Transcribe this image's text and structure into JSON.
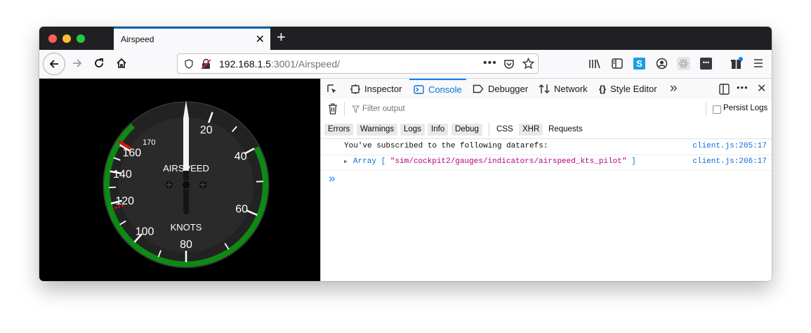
{
  "browser": {
    "tab_title": "Airspeed",
    "url_host": "192.168.1.5",
    "url_rest": ":3001/Airspeed/"
  },
  "gauge": {
    "label_top": "AIRSPEED",
    "label_bottom": "KNOTS",
    "scale_labels": [
      "20",
      "40",
      "60",
      "80",
      "100",
      "120",
      "140",
      "160",
      "170"
    ],
    "needle_value": 0,
    "colors": {
      "green_arc": "#0e8a14",
      "red_line": "#e01010",
      "dial": "#222222"
    }
  },
  "devtools": {
    "tabs": [
      "Inspector",
      "Console",
      "Debugger",
      "Network",
      "Style Editor"
    ],
    "active_tab": "Console",
    "filter_placeholder": "Filter output",
    "persist_logs": "Persist Logs",
    "categories": [
      "Errors",
      "Warnings",
      "Logs",
      "Info",
      "Debug"
    ],
    "categories2": [
      "CSS",
      "XHR",
      "Requests"
    ],
    "messages": [
      {
        "text": "You've subscribed to the following datarefs:",
        "source": "client.js:205:17"
      },
      {
        "prefix": "Array [ ",
        "value": "\"sim/cockpit2/gauges/indicators/airspeed_kts_pilot\"",
        "suffix": " ]",
        "source": "client.js:206:17"
      }
    ],
    "prompt": "»"
  }
}
